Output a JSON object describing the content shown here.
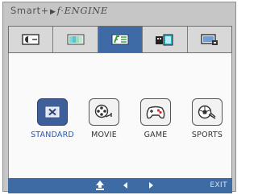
{
  "header": {
    "prefix": "Smart+",
    "arrow": "▶",
    "logo": "f·ENGINE"
  },
  "tabs": [
    {
      "name": "display-tab",
      "icon": "monitor-adjust-icon",
      "active": false
    },
    {
      "name": "color-tab",
      "icon": "color-bars-icon",
      "active": false
    },
    {
      "name": "fengine-tab",
      "icon": "f-engine-icon",
      "active": true
    },
    {
      "name": "audio-tab",
      "icon": "speaker-icon",
      "active": false
    },
    {
      "name": "setup-tab",
      "icon": "setup-monitor-icon",
      "active": false
    }
  ],
  "modes": [
    {
      "label": "STANDARD",
      "icon": "standard-icon",
      "selected": true
    },
    {
      "label": "MOVIE",
      "icon": "movie-reel-icon",
      "selected": false
    },
    {
      "label": "GAME",
      "icon": "gamepad-icon",
      "selected": false
    },
    {
      "label": "SPORTS",
      "icon": "soccer-ball-icon",
      "selected": false
    }
  ],
  "footer": {
    "up_icon": "up-arrow-icon",
    "left_icon": "left-arrow-icon",
    "right_icon": "right-arrow-icon",
    "exit_label": "EXIT"
  },
  "colors": {
    "accent_blue": "#3e6ba6",
    "selected_label": "#1d58c4",
    "panel_bg": "#c6c6c6"
  }
}
